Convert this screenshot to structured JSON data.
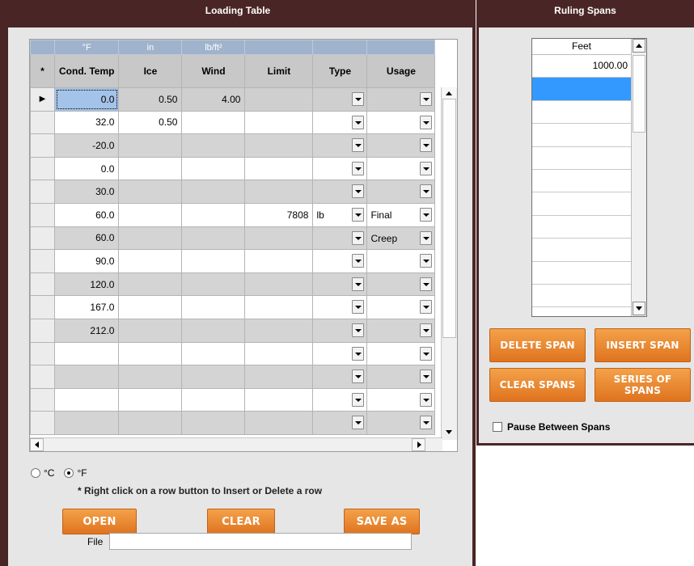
{
  "loading": {
    "title": "Loading Table",
    "units": [
      "°F",
      "in",
      "lb/ft²",
      "",
      "",
      ""
    ],
    "headers": {
      "rownum": "*",
      "temp": "Cond. Temp",
      "ice": "Ice",
      "wind": "Wind",
      "limit": "Limit",
      "type": "Type",
      "usage": "Usage"
    },
    "rows": [
      {
        "marker": "▶",
        "temp": "0.0",
        "ice": "0.50",
        "wind": "4.00",
        "limit": "",
        "type": "",
        "usage": ""
      },
      {
        "marker": "",
        "temp": "32.0",
        "ice": "0.50",
        "wind": "",
        "limit": "",
        "type": "",
        "usage": ""
      },
      {
        "marker": "",
        "temp": "-20.0",
        "ice": "",
        "wind": "",
        "limit": "",
        "type": "",
        "usage": ""
      },
      {
        "marker": "",
        "temp": "0.0",
        "ice": "",
        "wind": "",
        "limit": "",
        "type": "",
        "usage": ""
      },
      {
        "marker": "",
        "temp": "30.0",
        "ice": "",
        "wind": "",
        "limit": "",
        "type": "",
        "usage": ""
      },
      {
        "marker": "",
        "temp": "60.0",
        "ice": "",
        "wind": "",
        "limit": "7808",
        "type": "lb",
        "usage": "Final"
      },
      {
        "marker": "",
        "temp": "60.0",
        "ice": "",
        "wind": "",
        "limit": "",
        "type": "",
        "usage": "Creep"
      },
      {
        "marker": "",
        "temp": "90.0",
        "ice": "",
        "wind": "",
        "limit": "",
        "type": "",
        "usage": ""
      },
      {
        "marker": "",
        "temp": "120.0",
        "ice": "",
        "wind": "",
        "limit": "",
        "type": "",
        "usage": ""
      },
      {
        "marker": "",
        "temp": "167.0",
        "ice": "",
        "wind": "",
        "limit": "",
        "type": "",
        "usage": ""
      },
      {
        "marker": "",
        "temp": "212.0",
        "ice": "",
        "wind": "",
        "limit": "",
        "type": "",
        "usage": ""
      },
      {
        "marker": "",
        "temp": "",
        "ice": "",
        "wind": "",
        "limit": "",
        "type": "",
        "usage": ""
      },
      {
        "marker": "",
        "temp": "",
        "ice": "",
        "wind": "",
        "limit": "",
        "type": "",
        "usage": ""
      },
      {
        "marker": "",
        "temp": "",
        "ice": "",
        "wind": "",
        "limit": "",
        "type": "",
        "usage": ""
      },
      {
        "marker": "",
        "temp": "",
        "ice": "",
        "wind": "",
        "limit": "",
        "type": "",
        "usage": ""
      }
    ],
    "unit_options": {
      "celsius": "°C",
      "fahrenheit": "°F",
      "selected": "fahrenheit"
    },
    "note": "* Right click on a row button to Insert or Delete a row",
    "buttons": {
      "open": "OPEN",
      "clear": "CLEAR",
      "save_as": "SAVE AS"
    },
    "file_label": "File",
    "file_value": ""
  },
  "ruling": {
    "title": "Ruling Spans",
    "column_header": "Feet",
    "spans": [
      "1000.00",
      "",
      "",
      "",
      "",
      "",
      "",
      "",
      "",
      "",
      ""
    ],
    "selected_index": 1,
    "buttons": {
      "delete": "DELETE SPAN",
      "insert": "INSERT SPAN",
      "clear": "CLEAR SPANS",
      "series": "SERIES OF SPANS"
    },
    "pause_label": "Pause Between Spans",
    "pause_checked": false
  },
  "colors": {
    "frame": "#4a2525",
    "accent_orange": "#e8822e",
    "selection": "#3399ff",
    "header_blue": "#9fb3cc"
  }
}
